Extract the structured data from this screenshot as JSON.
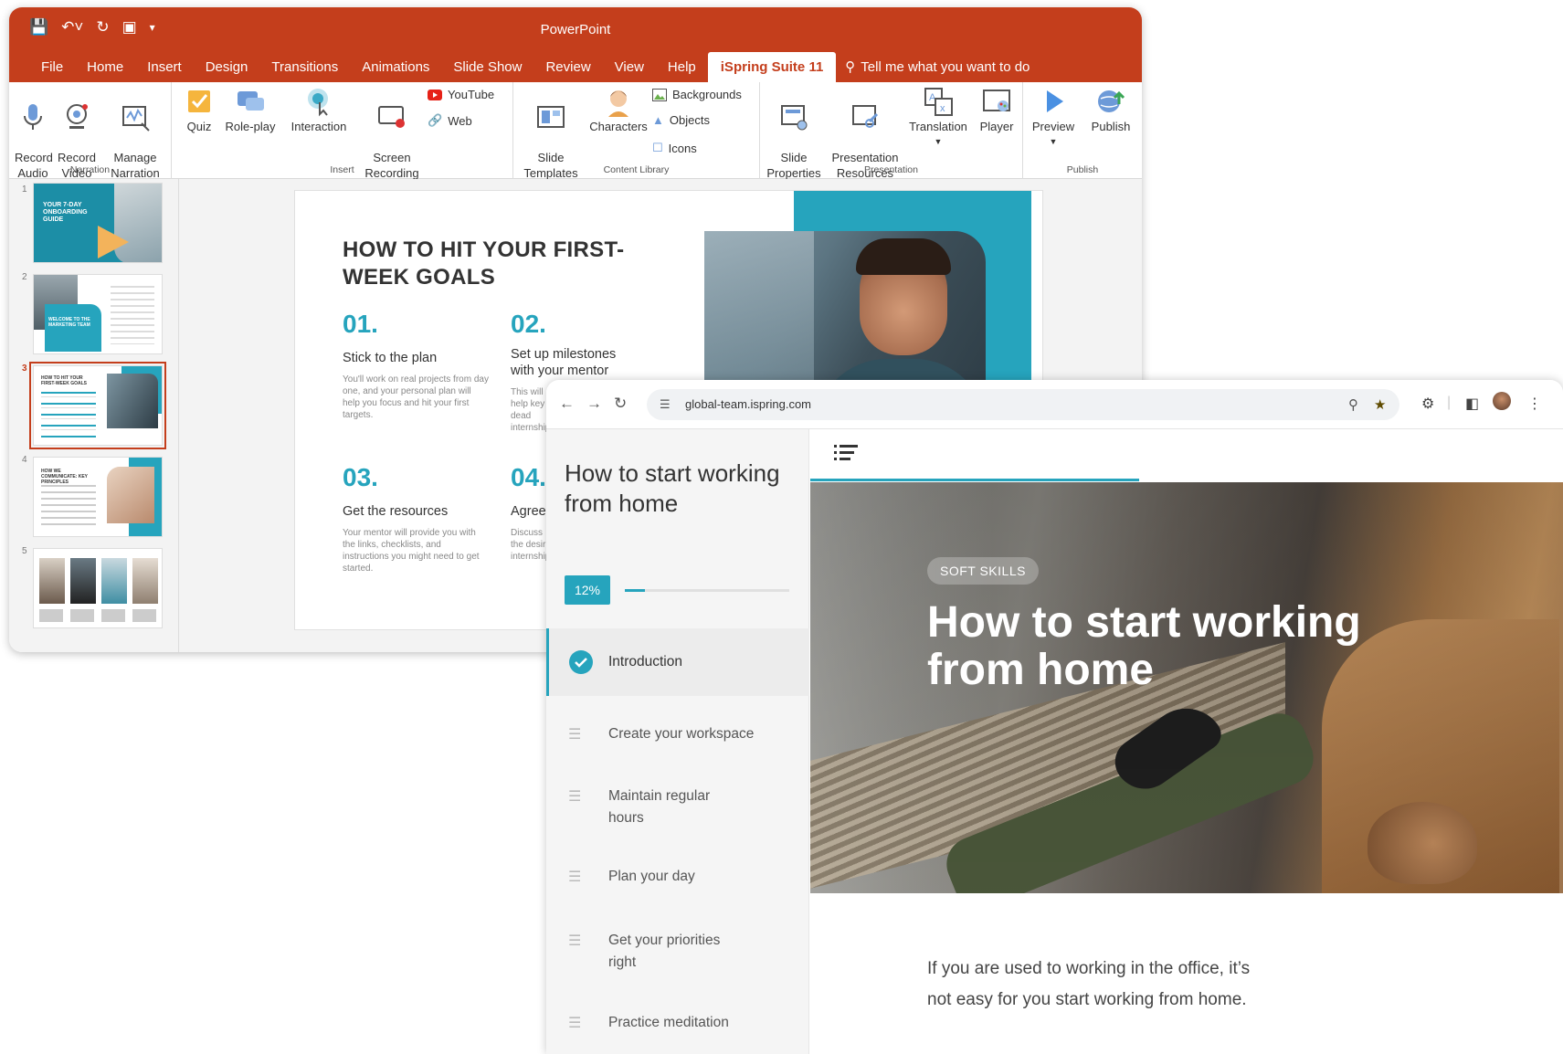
{
  "powerpoint": {
    "app_title": "PowerPoint",
    "tabs": [
      "File",
      "Home",
      "Insert",
      "Design",
      "Transitions",
      "Animations",
      "Slide Show",
      "Review",
      "View",
      "Help"
    ],
    "active_tab": "iSpring Suite 11",
    "tell_me": "Tell me what you want to do",
    "ribbon": {
      "narration": {
        "label": "Narration",
        "record_audio": "Record\nAudio",
        "record_video": "Record\nVideo",
        "manage_narration": "Manage\nNarration"
      },
      "insert": {
        "label": "Insert",
        "quiz": "Quiz",
        "role_play": "Role-play",
        "interaction": "Interaction",
        "screen_recording": "Screen\nRecording",
        "youtube": "YouTube",
        "web": "Web"
      },
      "content_library": {
        "label": "Content Library",
        "slide_templates": "Slide\nTemplates",
        "characters": "Characters",
        "backgrounds": "Backgrounds",
        "objects": "Objects",
        "icons": "Icons"
      },
      "presentation": {
        "label": "Presentation",
        "slide_properties": "Slide\nProperties",
        "presentation_resources": "Presentation\nResources",
        "translation": "Translation",
        "player": "Player"
      },
      "publish": {
        "label": "Publish",
        "preview": "Preview",
        "publish": "Publish"
      }
    },
    "thumbnails": [
      "1",
      "2",
      "3",
      "4",
      "5"
    ],
    "thumb_texts": {
      "t1": "YOUR 7-DAY ONBOARDING GUIDE",
      "t2": "WELCOME TO THE MARKETING TEAM",
      "t3": "HOW TO HIT YOUR FIRST-WEEK GOALS",
      "t4": "HOW WE COMMUNICATE: KEY PRINCIPLES"
    },
    "slide": {
      "title": "HOW TO HIT YOUR FIRST-WEEK GOALS",
      "items": [
        {
          "num": "01.",
          "head": "Stick to the plan",
          "text": "You'll work on real projects from day one, and your personal plan will help you focus and hit your first targets."
        },
        {
          "num": "02.",
          "head": "Set up milestones with your mentor",
          "text": "This will help key dead internship"
        },
        {
          "num": "03.",
          "head": "Get the resources",
          "text": "Your mentor will provide you with the links, checklists, and instructions you might need to get started."
        },
        {
          "num": "04.",
          "head": "Agree",
          "text": "Discuss the desir internship"
        }
      ]
    }
  },
  "browser": {
    "url": "global-team.ispring.com",
    "course_title": "How to start working from home",
    "progress": {
      "label": "12%",
      "value": 0.12
    },
    "lessons": [
      {
        "label": "Introduction",
        "state": "done"
      },
      {
        "label": "Create your workspace",
        "state": "todo"
      },
      {
        "label": "Maintain regular hours",
        "state": "todo"
      },
      {
        "label": "Plan your day",
        "state": "todo"
      },
      {
        "label": "Get your priorities right",
        "state": "todo"
      },
      {
        "label": "Practice meditation",
        "state": "todo"
      }
    ],
    "hero": {
      "tag": "SOFT SKILLS",
      "title": "How to start working from home"
    },
    "body_text": "If you are used to working in the office, it’s not easy for you start working from home."
  },
  "colors": {
    "pp_accent": "#c43e1c",
    "teal": "#26a4bd"
  }
}
